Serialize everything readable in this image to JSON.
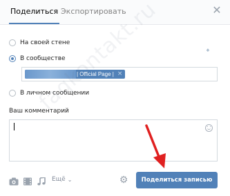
{
  "tabs": [
    {
      "label": "Поделиться",
      "active": true
    },
    {
      "label": "Экспортировать",
      "active": false
    }
  ],
  "close_icon": "close-icon",
  "share_options": [
    {
      "label": "На своей стене",
      "checked": false
    },
    {
      "label": "В сообществе",
      "checked": true
    },
    {
      "label": "В личном сообщении",
      "checked": false
    }
  ],
  "community_logo_text": "ф",
  "selected_group": {
    "visible_text": "| Official Page |",
    "remove_symbol": "×"
  },
  "comment": {
    "label": "Ваш комментарий",
    "value": ""
  },
  "attachments": {
    "icons": [
      "camera-icon",
      "video-icon",
      "music-icon"
    ],
    "more_label": "Ещё"
  },
  "submit_label": "Поделиться записью",
  "watermark": "faqkontakt.ru",
  "colors": {
    "accent": "#5181b8",
    "annotation_arrow": "#e02020"
  }
}
